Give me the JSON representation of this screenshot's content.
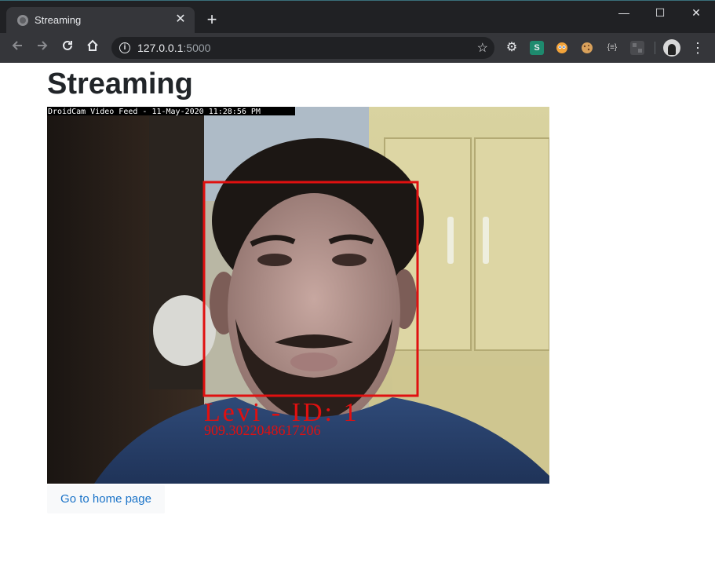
{
  "browser": {
    "tab_title": "Streaming",
    "tab_close": "✕",
    "new_tab": "+",
    "url_host": "127.0.0.1",
    "url_port": ":5000",
    "window_controls": {
      "minimize": "—",
      "maximize": "☐",
      "close": "✕"
    }
  },
  "page": {
    "title": "Streaming",
    "home_link": "Go to home page"
  },
  "video": {
    "overlay_caption": "DroidCam Video Feed - 11-May-2020 11:28:56 PM",
    "detection_label": "Levi - ID: 1",
    "detection_score": "909.3022048617206",
    "box_color": "#e01010"
  }
}
